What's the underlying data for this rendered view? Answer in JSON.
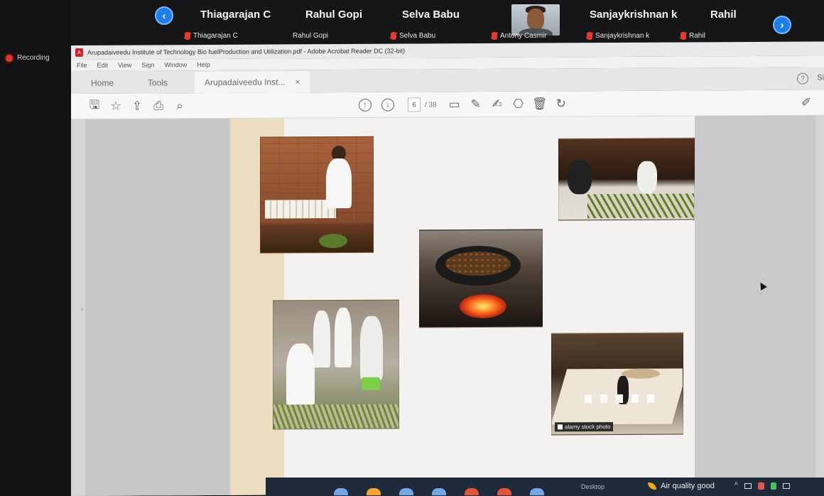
{
  "recording": {
    "label": "Recording"
  },
  "participants": [
    {
      "name": "Thiagarajan C",
      "tag": "Thiagarajan C"
    },
    {
      "name": "Rahul Gopi",
      "tag": "Rahul Gopi"
    },
    {
      "name": "Selva Babu",
      "tag": "Selva Babu"
    },
    {
      "name": "",
      "tag": "Antony Casmir"
    },
    {
      "name": "Sanjaykrishnan k",
      "tag": "Sanjaykrishnan k"
    },
    {
      "name": "Rahil",
      "tag": "Rahil"
    }
  ],
  "nav": {
    "prev": "‹",
    "next": "›"
  },
  "acrobat": {
    "title": "Arupadaiveedu Institute of Technology Bio fuelProduction and Utilization.pdf - Adobe Acrobat Reader DC (32-bit)",
    "menu": [
      "File",
      "Edit",
      "View",
      "Sign",
      "Window",
      "Help"
    ],
    "tabs": {
      "home": "Home",
      "tools": "Tools",
      "document": "Arupadaiveedu Inst...",
      "close": "×"
    },
    "help": "?",
    "signin": "Si",
    "page_current": "6",
    "page_total": "/ 38"
  },
  "watermark": "alamy stock photo",
  "taskbar": {
    "desktop": "Desktop",
    "air_quality": "Air quality good",
    "chevron": "^"
  },
  "colors": {
    "accent_blue": "#1f7fe6",
    "mute_red": "#e33b2f",
    "recording_red": "#e0342b",
    "page_beige": "#ecdcc0"
  }
}
